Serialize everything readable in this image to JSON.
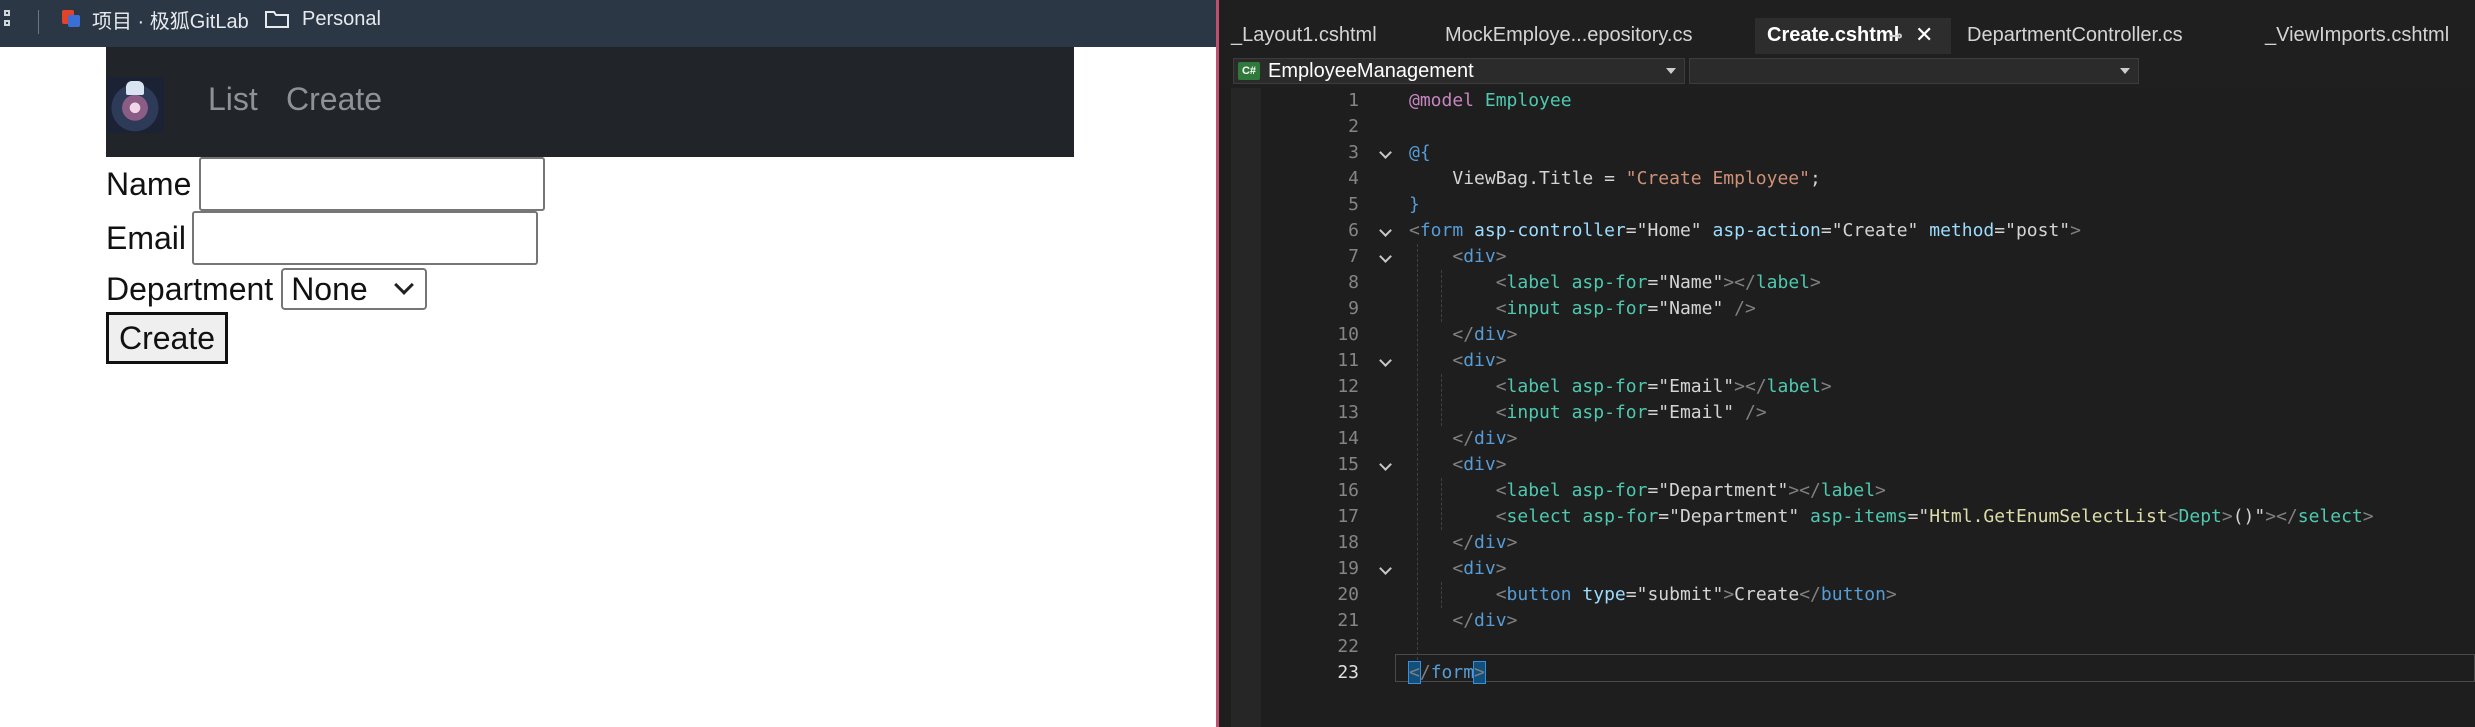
{
  "browser": {
    "bookmarks": [
      {
        "label": "项目 · 极狐GitLab",
        "icon": "gitlab-icon"
      },
      {
        "label": "Personal",
        "icon": "folder-icon"
      }
    ],
    "nav": {
      "logo": "site-logo",
      "links": [
        "List",
        "Create"
      ]
    },
    "form": {
      "name_label": "Name",
      "email_label": "Email",
      "department_label": "Department",
      "department_value": "None",
      "submit_label": "Create"
    }
  },
  "ide": {
    "tabs": [
      "_Layout1.cshtml",
      "MockEmploye...epository.cs",
      "Create.cshtml",
      "DepartmentController.cs",
      "_ViewImports.cshtml"
    ],
    "active_tab": "Create.cshtml",
    "project_dropdown": "EmployeeManagement",
    "member_dropdown": "",
    "line_numbers": [
      "1",
      "2",
      "3",
      "4",
      "5",
      "6",
      "7",
      "8",
      "9",
      "10",
      "11",
      "12",
      "13",
      "14",
      "15",
      "16",
      "17",
      "18",
      "19",
      "20",
      "21",
      "22",
      "23"
    ],
    "current_line": "23",
    "code": {
      "l1_directive": "@model",
      "l1_type": "Employee",
      "l3": "@{",
      "l4_prop": "ViewBag.Title = ",
      "l4_str": "\"Create Employee\"",
      "l4_end": ";",
      "l5": "}",
      "l6_controller": "\"Home\"",
      "l6_action": "\"Create\"",
      "l6_method": "\"post\"",
      "l8_for": "\"Name\"",
      "l9_for": "\"Name\"",
      "l12_for": "\"Email\"",
      "l13_for": "\"Email\"",
      "l16_for": "\"Department\"",
      "l17_for": "\"Department\"",
      "l17_items_pre": "\"",
      "l17_method": "Html.GetEnumSelectList",
      "l17_generic": "Dept",
      "l17_items_post": "()\"",
      "l20_type": "\"submit\"",
      "l20_text": "Create"
    },
    "colors": {
      "background": "#1e1e1e",
      "tag": "#569cd6",
      "attribute": "#4ec9b0",
      "string": "#ce9178"
    }
  }
}
